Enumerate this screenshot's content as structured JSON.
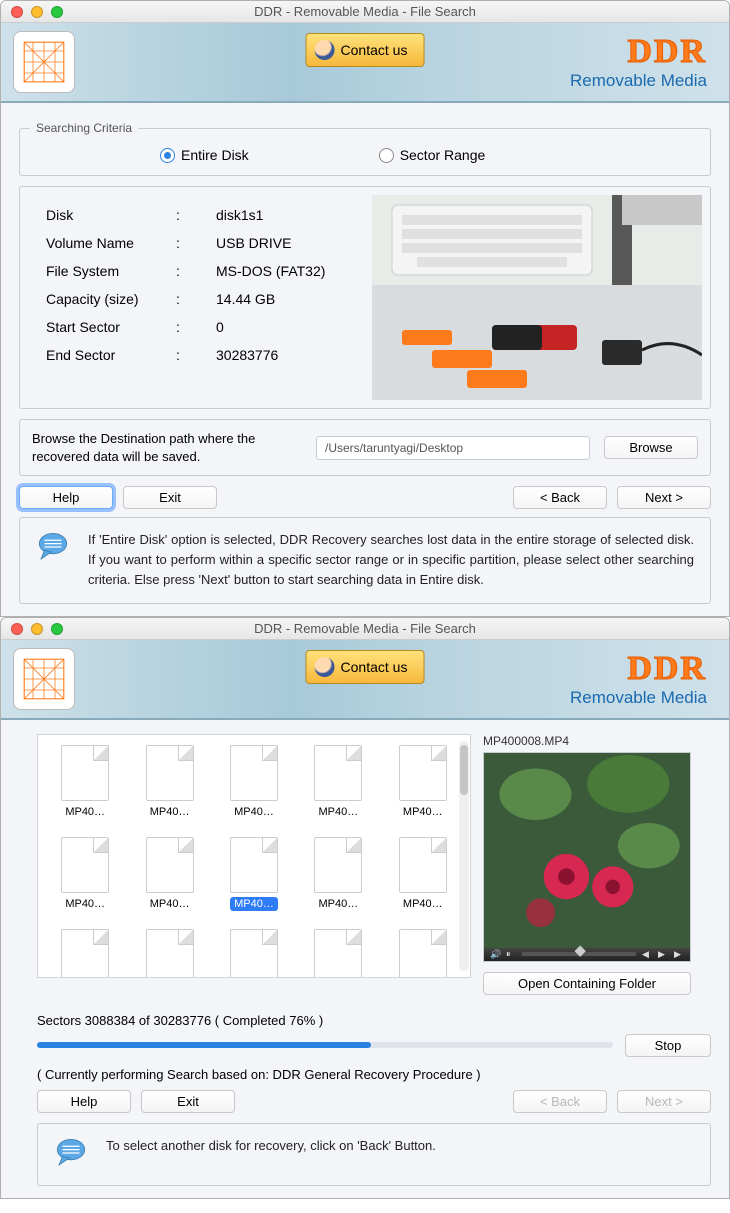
{
  "window1": {
    "title": "DDR - Removable Media - File Search",
    "contact_label": "Contact us",
    "brand_main": "DDR",
    "brand_sub": "Removable Media",
    "criteria": {
      "legend": "Searching Criteria",
      "entire_disk": "Entire Disk",
      "sector_range": "Sector Range"
    },
    "info": {
      "disk_label": "Disk",
      "disk_value": "disk1s1",
      "volume_label": "Volume Name",
      "volume_value": "USB DRIVE",
      "fs_label": "File System",
      "fs_value": "MS-DOS (FAT32)",
      "cap_label": "Capacity (size)",
      "cap_value": "14.44  GB",
      "start_label": "Start Sector",
      "start_value": "0",
      "end_label": "End Sector",
      "end_value": "30283776"
    },
    "browse_desc": "Browse the Destination path where the recovered data will be saved.",
    "path_value": "/Users/taruntyagi/Desktop",
    "browse_btn": "Browse",
    "help_btn": "Help",
    "exit_btn": "Exit",
    "back_btn": "< Back",
    "next_btn": "Next >",
    "tip": "If 'Entire Disk' option is selected, DDR Recovery searches lost data in the entire storage of selected disk. If you want to perform within a specific sector range or in specific partition, please select other searching criteria. Else press 'Next' button to start searching data in Entire disk."
  },
  "window2": {
    "title": "DDR - Removable Media - File Search",
    "contact_label": "Contact us",
    "brand_main": "DDR",
    "brand_sub": "Removable Media",
    "files": [
      "MP40…",
      "MP40…",
      "MP40…",
      "MP40…",
      "MP40…",
      "MP40…",
      "MP40…",
      "MP40…",
      "MP40…",
      "MP40…",
      "",
      "",
      "",
      "",
      ""
    ],
    "selected_index": 7,
    "preview_name": "MP400008.MP4",
    "open_folder_btn": "Open Containing Folder",
    "progress_text": "Sectors 3088384 of 30283776   ( Completed 76% )",
    "progress_percent": 58,
    "stop_btn": "Stop",
    "status_text": "( Currently performing Search based on: DDR General Recovery Procedure )",
    "help_btn": "Help",
    "exit_btn": "Exit",
    "back_btn": "< Back",
    "next_btn": "Next >",
    "tip": "To select another disk for recovery, click on 'Back' Button."
  }
}
